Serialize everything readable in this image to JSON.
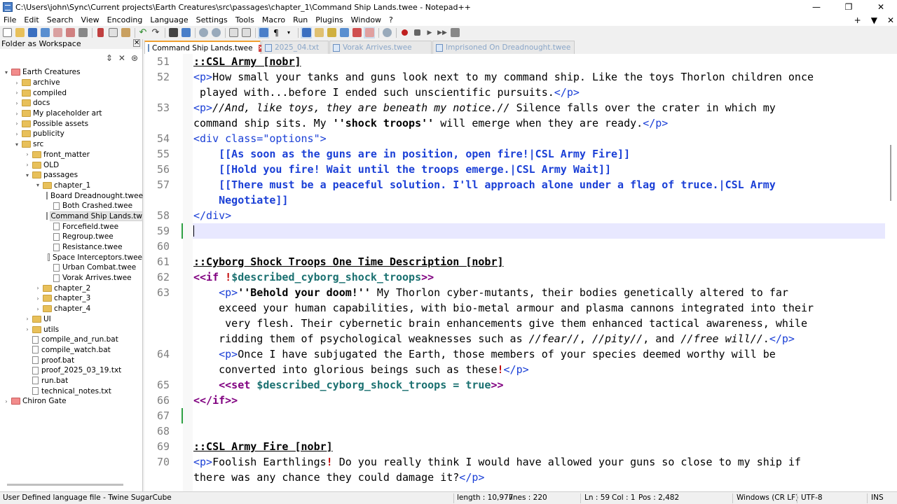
{
  "window": {
    "title": "C:\\Users\\john\\Sync\\Current projects\\Earth Creatures\\src\\passages\\chapter_1\\Command Ship Lands.twee - Notepad++",
    "minimize": "—",
    "maximize": "❐",
    "close": "✕"
  },
  "menu": {
    "items": [
      "File",
      "Edit",
      "Search",
      "View",
      "Encoding",
      "Language",
      "Settings",
      "Tools",
      "Macro",
      "Run",
      "Plugins",
      "Window",
      "?"
    ],
    "right": [
      "+",
      "▼",
      "✕"
    ]
  },
  "panel": {
    "title": "Folder as Workspace",
    "close": "✕",
    "tools": [
      "⇕",
      "✕",
      "⊛"
    ],
    "tree": [
      {
        "label": "Earth Creatures",
        "depth": 0,
        "kind": "root",
        "arrow": "▾"
      },
      {
        "label": "archive",
        "depth": 1,
        "kind": "folder",
        "arrow": "›"
      },
      {
        "label": "compiled",
        "depth": 1,
        "kind": "folder",
        "arrow": "›"
      },
      {
        "label": "docs",
        "depth": 1,
        "kind": "folder",
        "arrow": "›"
      },
      {
        "label": "My placeholder art",
        "depth": 1,
        "kind": "folder",
        "arrow": "›"
      },
      {
        "label": "Possible assets",
        "depth": 1,
        "kind": "folder",
        "arrow": "›"
      },
      {
        "label": "publicity",
        "depth": 1,
        "kind": "folder",
        "arrow": "›"
      },
      {
        "label": "src",
        "depth": 1,
        "kind": "folder",
        "arrow": "▾"
      },
      {
        "label": "front_matter",
        "depth": 2,
        "kind": "folder",
        "arrow": "›"
      },
      {
        "label": "OLD",
        "depth": 2,
        "kind": "folder",
        "arrow": "›"
      },
      {
        "label": "passages",
        "depth": 2,
        "kind": "folder",
        "arrow": "▾"
      },
      {
        "label": "chapter_1",
        "depth": 3,
        "kind": "folder",
        "arrow": "▾"
      },
      {
        "label": "Board Dreadnought.twee",
        "depth": 4,
        "kind": "file",
        "arrow": ""
      },
      {
        "label": "Both Crashed.twee",
        "depth": 4,
        "kind": "file",
        "arrow": ""
      },
      {
        "label": "Command Ship Lands.tw",
        "depth": 4,
        "kind": "file",
        "arrow": "",
        "selected": true
      },
      {
        "label": "Forcefield.twee",
        "depth": 4,
        "kind": "file",
        "arrow": ""
      },
      {
        "label": "Regroup.twee",
        "depth": 4,
        "kind": "file",
        "arrow": ""
      },
      {
        "label": "Resistance.twee",
        "depth": 4,
        "kind": "file",
        "arrow": ""
      },
      {
        "label": "Space Interceptors.twee",
        "depth": 4,
        "kind": "file",
        "arrow": ""
      },
      {
        "label": "Urban Combat.twee",
        "depth": 4,
        "kind": "file",
        "arrow": ""
      },
      {
        "label": "Vorak Arrives.twee",
        "depth": 4,
        "kind": "file",
        "arrow": ""
      },
      {
        "label": "chapter_2",
        "depth": 3,
        "kind": "folder",
        "arrow": "›"
      },
      {
        "label": "chapter_3",
        "depth": 3,
        "kind": "folder",
        "arrow": "›"
      },
      {
        "label": "chapter_4",
        "depth": 3,
        "kind": "folder",
        "arrow": "›"
      },
      {
        "label": "UI",
        "depth": 2,
        "kind": "folder",
        "arrow": "›"
      },
      {
        "label": "utils",
        "depth": 2,
        "kind": "folder",
        "arrow": "›"
      },
      {
        "label": "compile_and_run.bat",
        "depth": 2,
        "kind": "file",
        "arrow": ""
      },
      {
        "label": "compile_watch.bat",
        "depth": 2,
        "kind": "file",
        "arrow": ""
      },
      {
        "label": "proof.bat",
        "depth": 2,
        "kind": "file",
        "arrow": ""
      },
      {
        "label": "proof_2025_03_19.txt",
        "depth": 2,
        "kind": "file",
        "arrow": ""
      },
      {
        "label": "run.bat",
        "depth": 2,
        "kind": "file",
        "arrow": ""
      },
      {
        "label": "technical_notes.txt",
        "depth": 2,
        "kind": "file",
        "arrow": ""
      },
      {
        "label": "Chiron Gate",
        "depth": 0,
        "kind": "root",
        "arrow": "›"
      }
    ]
  },
  "tabs": [
    {
      "label": "Command Ship Lands.twee",
      "active": true,
      "close": "✕"
    },
    {
      "label": "2025_04.txt",
      "active": false
    },
    {
      "label": "Vorak Arrives.twee",
      "active": false
    },
    {
      "label": "Imprisoned On Dreadnought.twee",
      "active": false
    }
  ],
  "editor": {
    "lines": [
      {
        "num": "51",
        "segs": [
          {
            "t": "::CSL Army [nobr]",
            "c": "hdr"
          }
        ]
      },
      {
        "num": "52",
        "segs": [
          {
            "t": "<p>",
            "c": "tag"
          },
          {
            "t": "How small your tanks and guns look next to my command ship. Like the toys Thorlon children once"
          }
        ]
      },
      {
        "num": "",
        "segs": [
          {
            "t": " played with...before I ended such unscientific pursuits."
          },
          {
            "t": "</p>",
            "c": "tag"
          }
        ]
      },
      {
        "num": "53",
        "segs": [
          {
            "t": "<p>",
            "c": "tag"
          },
          {
            "t": "//And, like toys, they are beneath my notice.//",
            "c": "it"
          },
          {
            "t": " Silence falls over the crater in which my"
          }
        ]
      },
      {
        "num": "",
        "segs": [
          {
            "t": "command ship sits. My "
          },
          {
            "t": "''shock troops''",
            "c": "b"
          },
          {
            "t": " will emerge when they are ready."
          },
          {
            "t": "</p>",
            "c": "tag"
          }
        ]
      },
      {
        "num": "54",
        "segs": [
          {
            "t": "<div class=\"options\">",
            "c": "tag"
          }
        ]
      },
      {
        "num": "55",
        "segs": [
          {
            "t": "    [[As soon as the guns are in position, open fire!|CSL Army Fire]]",
            "c": "link"
          }
        ]
      },
      {
        "num": "56",
        "segs": [
          {
            "t": "    [[Hold you fire! Wait until the troops emerge.|CSL Army Wait]]",
            "c": "link"
          }
        ]
      },
      {
        "num": "57",
        "segs": [
          {
            "t": "    [[There must be a peaceful solution. I'll approach alone under a flag of truce.|CSL Army",
            "c": "link"
          }
        ]
      },
      {
        "num": "",
        "segs": [
          {
            "t": "    Negotiate]]",
            "c": "link"
          }
        ]
      },
      {
        "num": "58",
        "segs": [
          {
            "t": "</div>",
            "c": "tag"
          }
        ]
      },
      {
        "num": "59",
        "segs": [
          {
            "t": ""
          }
        ],
        "current": true,
        "changed": true
      },
      {
        "num": "60",
        "segs": [
          {
            "t": ""
          }
        ]
      },
      {
        "num": "61",
        "segs": [
          {
            "t": "::Cyborg Shock Troops One Time Description [nobr]",
            "c": "hdr"
          }
        ]
      },
      {
        "num": "62",
        "segs": [
          {
            "t": "<<if ",
            "c": "mac"
          },
          {
            "t": "!",
            "c": "red"
          },
          {
            "t": "$described_cyborg_shock_troops",
            "c": "var"
          },
          {
            "t": ">>",
            "c": "mac"
          }
        ]
      },
      {
        "num": "63",
        "segs": [
          {
            "t": "    "
          },
          {
            "t": "<p>",
            "c": "tag"
          },
          {
            "t": "''Behold your doom!''",
            "c": "b"
          },
          {
            "t": " My Thorlon cyber-mutants, their bodies genetically altered to far"
          }
        ]
      },
      {
        "num": "",
        "segs": [
          {
            "t": "    exceed your human capabilities, with bio-metal armour and plasma cannons integrated into their"
          }
        ]
      },
      {
        "num": "",
        "segs": [
          {
            "t": "     very flesh. Their cybernetic brain enhancements give them enhanced tactical awareness, while"
          }
        ]
      },
      {
        "num": "",
        "segs": [
          {
            "t": "    ridding them of psychological weaknesses such as "
          },
          {
            "t": "//fear//",
            "c": "it"
          },
          {
            "t": ", "
          },
          {
            "t": "//pity//",
            "c": "it"
          },
          {
            "t": ", and "
          },
          {
            "t": "//free will//",
            "c": "it"
          },
          {
            "t": "."
          },
          {
            "t": "</p>",
            "c": "tag"
          }
        ]
      },
      {
        "num": "64",
        "segs": [
          {
            "t": "    "
          },
          {
            "t": "<p>",
            "c": "tag"
          },
          {
            "t": "Once I have subjugated the Earth, those members of your species deemed worthy will be"
          }
        ]
      },
      {
        "num": "",
        "segs": [
          {
            "t": "    converted into glorious beings such as these"
          },
          {
            "t": "!",
            "c": "red"
          },
          {
            "t": "</p>",
            "c": "tag"
          }
        ]
      },
      {
        "num": "65",
        "segs": [
          {
            "t": "    "
          },
          {
            "t": "<<set ",
            "c": "mac"
          },
          {
            "t": "$described_cyborg_shock_troops",
            "c": "var"
          },
          {
            "t": " = true",
            "c": "var"
          },
          {
            "t": ">>",
            "c": "mac"
          }
        ]
      },
      {
        "num": "66",
        "segs": [
          {
            "t": "<</if>>",
            "c": "mac"
          }
        ]
      },
      {
        "num": "67",
        "segs": [
          {
            "t": ""
          }
        ],
        "changed": true
      },
      {
        "num": "68",
        "segs": [
          {
            "t": ""
          }
        ]
      },
      {
        "num": "69",
        "segs": [
          {
            "t": "::CSL Army Fire [nobr]",
            "c": "hdr"
          }
        ]
      },
      {
        "num": "70",
        "segs": [
          {
            "t": "<p>",
            "c": "tag"
          },
          {
            "t": "Foolish Earthlings"
          },
          {
            "t": "!",
            "c": "red"
          },
          {
            "t": " Do you really think I would have allowed your guns so close to my ship if"
          }
        ]
      },
      {
        "num": "",
        "segs": [
          {
            "t": "there was any chance they could damage it?"
          },
          {
            "t": "</p>",
            "c": "tag"
          }
        ]
      }
    ]
  },
  "status": {
    "lang": "User Defined language file - Twine SugarCube",
    "length": "length : 10,977",
    "lines": "lines : 220",
    "ln": "Ln : 59",
    "col": "Col : 1",
    "pos": "Pos : 2,482",
    "eol": "Windows (CR LF)",
    "enc": "UTF-8",
    "mode": "INS"
  }
}
